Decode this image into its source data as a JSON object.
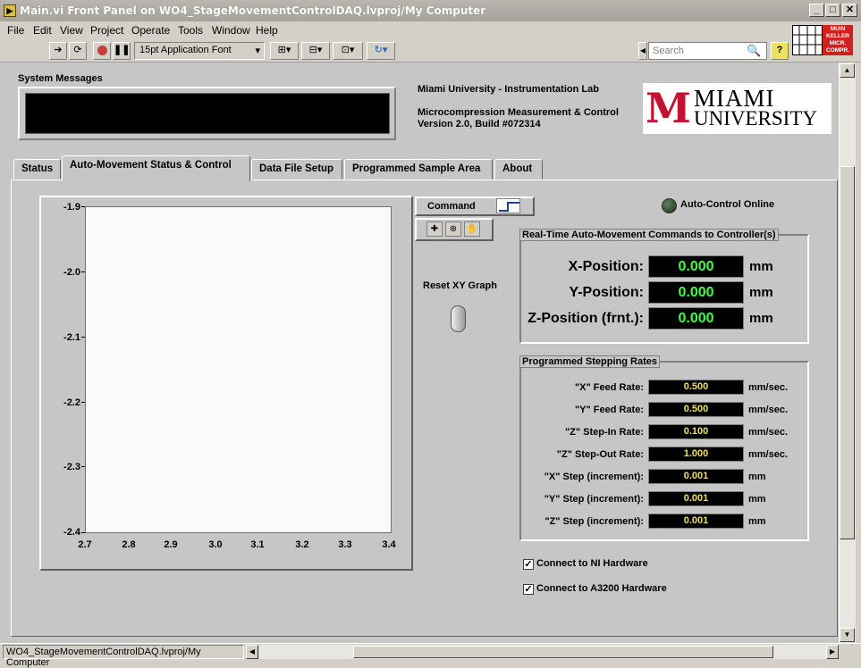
{
  "window": {
    "title": "Main.vi Front Panel on WO4_StageMovementControlDAQ.lvproj/My Computer",
    "minimize": "_",
    "maximize": "□",
    "close": "✕"
  },
  "menu": [
    "File",
    "Edit",
    "View",
    "Project",
    "Operate",
    "Tools",
    "Window",
    "Help"
  ],
  "toolbar": {
    "font_ring": "15pt Application Font",
    "search_placeholder": "Search"
  },
  "system_messages": {
    "label": "System Messages",
    "text": ""
  },
  "info": {
    "lab": "Miami University - Instrumentation Lab",
    "product": "Microcompression Measurement & Control",
    "version": "Version 2.0, Build #072314"
  },
  "logo": {
    "mark": "M",
    "line1": "MIAMI",
    "line2": "UNIVERSITY"
  },
  "icon_badge": [
    "MUIN",
    "KELLER",
    "MICR.",
    "COMPR."
  ],
  "tabs": [
    "Status",
    "Auto-Movement Status & Control",
    "Data File Setup",
    "Programmed Sample Area",
    "About"
  ],
  "active_tab": "Auto-Movement Status & Control",
  "graph": {
    "y_ticks": [
      "-1.9",
      "-2.0",
      "-2.1",
      "-2.2",
      "-2.3",
      "-2.4"
    ],
    "x_ticks": [
      "2.7",
      "2.8",
      "2.9",
      "3.0",
      "3.1",
      "3.2",
      "3.3",
      "3.4"
    ],
    "command_label": "Command",
    "reset_label": "Reset XY Graph"
  },
  "led": {
    "label": "Auto-Control Online",
    "on": false
  },
  "realtime": {
    "title": "Real-Time Auto-Movement Commands to Controller(s)",
    "rows": [
      {
        "label": "X-Position:",
        "value": "0.000",
        "unit": "mm"
      },
      {
        "label": "Y-Position:",
        "value": "0.000",
        "unit": "mm"
      },
      {
        "label": "Z-Position (frnt.):",
        "value": "0.000",
        "unit": "mm"
      }
    ]
  },
  "stepping": {
    "title": "Programmed Stepping Rates",
    "rows": [
      {
        "label": "\"X\" Feed Rate:",
        "value": "0.500",
        "unit": "mm/sec."
      },
      {
        "label": "\"Y\" Feed Rate:",
        "value": "0.500",
        "unit": "mm/sec."
      },
      {
        "label": "\"Z\" Step-In Rate:",
        "value": "0.100",
        "unit": "mm/sec."
      },
      {
        "label": "\"Z\" Step-Out Rate:",
        "value": "1.000",
        "unit": "mm/sec."
      },
      {
        "label": "\"X\" Step (increment):",
        "value": "0.001",
        "unit": "mm"
      },
      {
        "label": "\"Y\" Step (increment):",
        "value": "0.001",
        "unit": "mm"
      },
      {
        "label": "\"Z\" Step (increment):",
        "value": "0.001",
        "unit": "mm"
      }
    ]
  },
  "checkboxes": [
    {
      "label": "Connect to NI Hardware",
      "checked": true
    },
    {
      "label": "Connect to A3200 Hardware",
      "checked": true
    }
  ],
  "statusbar": {
    "path": "WO4_StageMovementControlDAQ.lvproj/My Computer"
  }
}
